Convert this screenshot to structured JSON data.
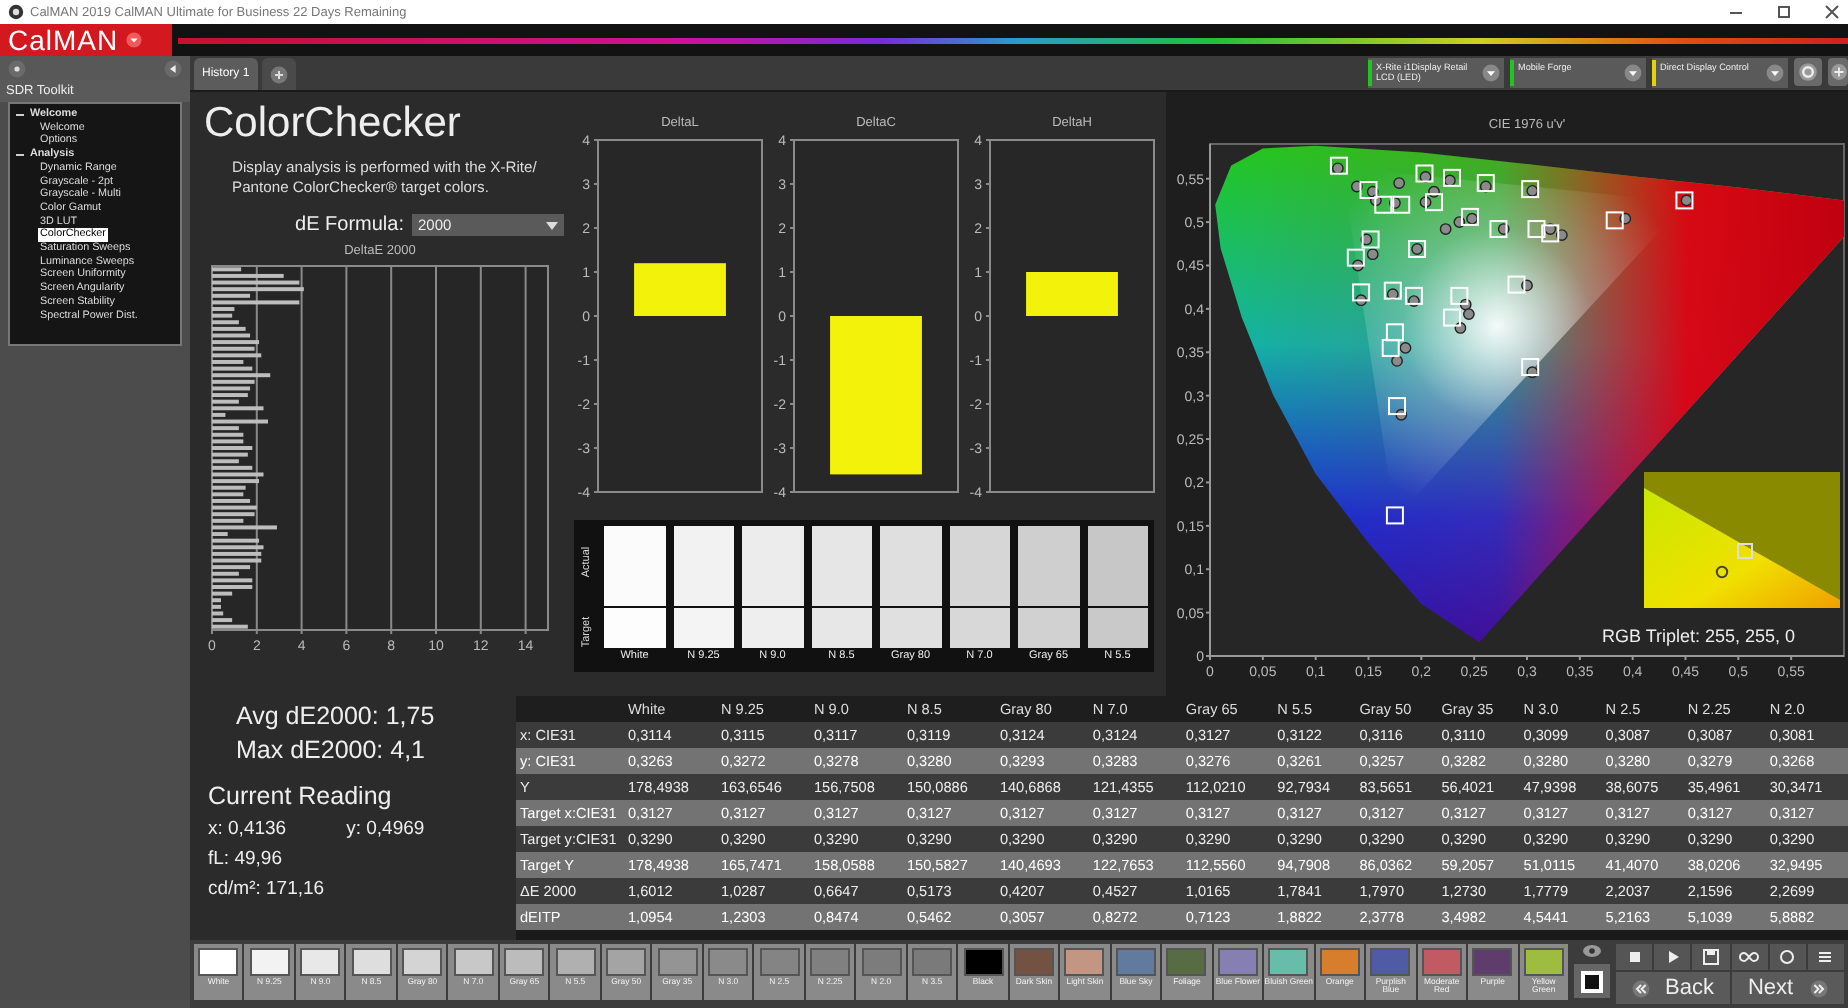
{
  "window": {
    "title": "CalMAN 2019 CalMAN Ultimate for Business 22 Days Remaining"
  },
  "app": {
    "logo": "CalMAN"
  },
  "sidebar": {
    "heading": "SDR Toolkit",
    "items": [
      {
        "label": "Welcome",
        "expanded": true,
        "selected": false,
        "children": [
          {
            "label": "Welcome",
            "selected": false
          },
          {
            "label": "Options",
            "selected": false
          }
        ]
      },
      {
        "label": "Analysis",
        "expanded": true,
        "selected": false,
        "children": [
          {
            "label": "Dynamic Range",
            "selected": false
          },
          {
            "label": "Grayscale - 2pt",
            "selected": false
          },
          {
            "label": "Grayscale - Multi",
            "selected": false
          },
          {
            "label": "Color Gamut",
            "selected": false
          },
          {
            "label": "3D LUT",
            "selected": false
          },
          {
            "label": "ColorChecker",
            "selected": true
          },
          {
            "label": "Saturation Sweeps",
            "selected": false
          },
          {
            "label": "Luminance Sweeps",
            "selected": false
          },
          {
            "label": "Screen Uniformity",
            "selected": false
          },
          {
            "label": "Screen Angularity",
            "selected": false
          },
          {
            "label": "Screen Stability",
            "selected": false
          },
          {
            "label": "Spectral Power Dist.",
            "selected": false
          }
        ]
      }
    ]
  },
  "tabs": [
    {
      "label": "History 1",
      "selected": true
    }
  ],
  "devices": [
    {
      "label": "X-Rite i1Display Retail LCD (LED)",
      "color": "#22c422"
    },
    {
      "label": "Mobile Forge",
      "color": "#22c422"
    },
    {
      "label": "Direct Display Control",
      "color": "#e0d410"
    }
  ],
  "page": {
    "title": "ColorChecker",
    "description": "Display analysis is performed with the X-Rite/ Pantone ColorChecker® target colors.",
    "formula_label": "dE Formula:",
    "formula_value": "2000"
  },
  "delta_e_chart": {
    "chart_data": {
      "type": "bar",
      "orientation": "horizontal",
      "title": "DeltaE 2000",
      "grid": true,
      "xlim": [
        0,
        15
      ],
      "xticks": [
        0,
        2,
        4,
        6,
        8,
        10,
        12,
        14
      ],
      "values": [
        1.3,
        3.2,
        3.9,
        4.1,
        1.7,
        3.9,
        1.0,
        0.9,
        1.2,
        1.5,
        1.7,
        2.1,
        1.9,
        2.2,
        1.4,
        1.8,
        2.6,
        1.9,
        1.7,
        1.6,
        1.2,
        2.3,
        0.6,
        2.5,
        1.2,
        1.4,
        1.4,
        1.8,
        1.6,
        1.2,
        1.8,
        2.3,
        2.1,
        1.5,
        1.4,
        1.7,
        2.0,
        1.9,
        1.4,
        2.9,
        0.7,
        2.1,
        2.3,
        2.2,
        2.2,
        1.7,
        1.2,
        1.8,
        1.8,
        0.9,
        0.4,
        0.4,
        0.5,
        0.9,
        1.6
      ]
    }
  },
  "delta_charts": [
    {
      "chart_data": {
        "type": "bar",
        "orientation": "vertical",
        "title": "DeltaL",
        "categories": [
          null
        ],
        "ylim": [
          -4,
          4
        ],
        "yticks": [
          -4,
          -3,
          -2,
          -1,
          0,
          1,
          2,
          3,
          4
        ],
        "values": [
          1.2
        ]
      }
    },
    {
      "chart_data": {
        "type": "bar",
        "orientation": "vertical",
        "title": "DeltaC",
        "categories": [
          null
        ],
        "ylim": [
          -4,
          4
        ],
        "yticks": [
          -4,
          -3,
          -2,
          -1,
          0,
          1,
          2,
          3,
          4
        ],
        "values": [
          -3.6
        ]
      }
    },
    {
      "chart_data": {
        "type": "bar",
        "orientation": "vertical",
        "title": "DeltaH",
        "categories": [
          null
        ],
        "ylim": [
          -4,
          4
        ],
        "yticks": [
          -4,
          -3,
          -2,
          -1,
          0,
          1,
          2,
          3,
          4
        ],
        "values": [
          1.0
        ]
      }
    }
  ],
  "patch_panel": {
    "actual_label": "Actual",
    "target_label": "Target",
    "patches": [
      {
        "label": "White",
        "actual": {
          "color": "#fbfbfb"
        },
        "target": {
          "color": "#fdfdfd"
        }
      },
      {
        "label": "N 9.25",
        "actual": {
          "color": "#f2f2f2"
        },
        "target": {
          "color": "#f4f4f4"
        }
      },
      {
        "label": "N 9.0",
        "actual": {
          "color": "#ececec"
        },
        "target": {
          "color": "#eeeeee"
        }
      },
      {
        "label": "N 8.5",
        "actual": {
          "color": "#e6e6e6"
        },
        "target": {
          "color": "#e7e7e7"
        }
      },
      {
        "label": "Gray 80",
        "actual": {
          "color": "#dfdfdf"
        },
        "target": {
          "color": "#e0e0e0"
        }
      },
      {
        "label": "N 7.0",
        "actual": {
          "color": "#d6d6d6"
        },
        "target": {
          "color": "#d8d8d8"
        }
      },
      {
        "label": "Gray 65",
        "actual": {
          "color": "#cfcfcf"
        },
        "target": {
          "color": "#d1d1d1"
        }
      },
      {
        "label": "N 5.5",
        "actual": {
          "color": "#c7c7c7"
        },
        "target": {
          "color": "#c9c9c9"
        }
      }
    ]
  },
  "cie_chart": {
    "chart_data": {
      "type": "scatter",
      "title": "CIE 1976 u'v'",
      "xlim": [
        0,
        0.6
      ],
      "ylim": [
        0,
        0.59
      ],
      "xticks": [
        {
          "value": 0,
          "label": "0"
        },
        {
          "value": 0.05,
          "label": "0,05"
        },
        {
          "value": 0.1,
          "label": "0,1"
        },
        {
          "value": 0.15,
          "label": "0,15"
        },
        {
          "value": 0.2,
          "label": "0,2"
        },
        {
          "value": 0.25,
          "label": "0,25"
        },
        {
          "value": 0.3,
          "label": "0,3"
        },
        {
          "value": 0.35,
          "label": "0,35"
        },
        {
          "value": 0.4,
          "label": "0,4"
        },
        {
          "value": 0.45,
          "label": "0,45"
        },
        {
          "value": 0.5,
          "label": "0,5"
        },
        {
          "value": 0.55,
          "label": "0,55"
        }
      ],
      "yticks": [
        {
          "value": 0,
          "label": "0"
        },
        {
          "value": 0.05,
          "label": "0,05"
        },
        {
          "value": 0.1,
          "label": "0,1"
        },
        {
          "value": 0.15,
          "label": "0,15"
        },
        {
          "value": 0.2,
          "label": "0,2"
        },
        {
          "value": 0.25,
          "label": "0,25"
        },
        {
          "value": 0.3,
          "label": "0,3"
        },
        {
          "value": 0.35,
          "label": "0,35"
        },
        {
          "value": 0.4,
          "label": "0,4"
        },
        {
          "value": 0.45,
          "label": "0,45"
        },
        {
          "value": 0.5,
          "label": "0,5"
        },
        {
          "value": 0.55,
          "label": "0,55"
        }
      ],
      "series": [
        {
          "marker": "circle",
          "color": "#8a8a8a",
          "x": [
            0.121,
            0.139,
            0.154,
            0.157,
            0.175,
            0.179,
            0.204,
            0.212,
            0.204,
            0.227,
            0.261,
            0.305,
            0.248,
            0.236,
            0.223,
            0.278,
            0.322,
            0.333,
            0.393,
            0.451,
            0.148,
            0.154,
            0.196,
            0.14,
            0.143,
            0.173,
            0.193,
            0.242,
            0.245,
            0.237,
            0.3,
            0.185,
            0.177,
            0.181,
            0.305
          ],
          "values": [
            0.562,
            0.541,
            0.535,
            0.525,
            0.522,
            0.545,
            0.523,
            0.535,
            0.552,
            0.548,
            0.541,
            0.536,
            0.504,
            0.5,
            0.492,
            0.492,
            0.492,
            0.485,
            0.504,
            0.525,
            0.48,
            0.463,
            0.469,
            0.45,
            0.41,
            0.417,
            0.409,
            0.405,
            0.394,
            0.378,
            0.427,
            0.355,
            0.34,
            0.278,
            0.327
          ]
        },
        {
          "marker": "square",
          "color": "#ffffff",
          "x": [
            0.122,
            0.203,
            0.229,
            0.261,
            0.303,
            0.212,
            0.181,
            0.164,
            0.15,
            0.246,
            0.273,
            0.309,
            0.322,
            0.383,
            0.449,
            0.152,
            0.138,
            0.196,
            0.143,
            0.173,
            0.193,
            0.236,
            0.229,
            0.29,
            0.175,
            0.171,
            0.177,
            0.303,
            0.175
          ],
          "values": [
            0.565,
            0.556,
            0.551,
            0.545,
            0.538,
            0.523,
            0.52,
            0.52,
            0.537,
            0.506,
            0.492,
            0.492,
            0.487,
            0.502,
            0.525,
            0.48,
            0.459,
            0.469,
            0.419,
            0.421,
            0.415,
            0.415,
            0.39,
            0.428,
            0.373,
            0.355,
            0.288,
            0.333,
            0.162
          ]
        }
      ]
    },
    "inset_label": "RGB Triplet: 255, 255, 0"
  },
  "summary": {
    "avg": "Avg dE2000: 1,75",
    "max": "Max dE2000: 4,1",
    "heading": "Current Reading",
    "x": "x: 0,4136",
    "y": "y: 0,4969",
    "fl": "fL: 49,96",
    "luminance": "cd/m²: 171,16"
  },
  "table": {
    "columns": [
      "White",
      "N 9.25",
      "N 9.0",
      "N 8.5",
      "Gray 80",
      "N 7.0",
      "Gray 65",
      "N 5.5",
      "Gray 50",
      "Gray 35",
      "N 3.0",
      "N 2.5",
      "N 2.25",
      "N 2.0"
    ],
    "rows": [
      {
        "label": "x: CIE31",
        "cells": [
          "0,3114",
          "0,3115",
          "0,3117",
          "0,3119",
          "0,3124",
          "0,3124",
          "0,3127",
          "0,3122",
          "0,3116",
          "0,3110",
          "0,3099",
          "0,3087",
          "0,3087",
          "0,3081"
        ]
      },
      {
        "label": "y: CIE31",
        "cells": [
          "0,3263",
          "0,3272",
          "0,3278",
          "0,3280",
          "0,3293",
          "0,3283",
          "0,3276",
          "0,3261",
          "0,3257",
          "0,3282",
          "0,3280",
          "0,3280",
          "0,3279",
          "0,3268"
        ]
      },
      {
        "label": "Y",
        "cells": [
          "178,4938",
          "163,6546",
          "156,7508",
          "150,0886",
          "140,6868",
          "121,4355",
          "112,0210",
          "92,7934",
          "83,5651",
          "56,4021",
          "47,9398",
          "38,6075",
          "35,4961",
          "30,3471"
        ]
      },
      {
        "label": "Target x:CIE31",
        "cells": [
          "0,3127",
          "0,3127",
          "0,3127",
          "0,3127",
          "0,3127",
          "0,3127",
          "0,3127",
          "0,3127",
          "0,3127",
          "0,3127",
          "0,3127",
          "0,3127",
          "0,3127",
          "0,3127"
        ]
      },
      {
        "label": "Target y:CIE31",
        "cells": [
          "0,3290",
          "0,3290",
          "0,3290",
          "0,3290",
          "0,3290",
          "0,3290",
          "0,3290",
          "0,3290",
          "0,3290",
          "0,3290",
          "0,3290",
          "0,3290",
          "0,3290",
          "0,3290"
        ]
      },
      {
        "label": "Target Y",
        "cells": [
          "178,4938",
          "165,7471",
          "158,0588",
          "150,5827",
          "140,4693",
          "122,7653",
          "112,5560",
          "94,7908",
          "86,0362",
          "59,2057",
          "51,0115",
          "41,4070",
          "38,0206",
          "32,9495"
        ]
      },
      {
        "label": "ΔE 2000",
        "cells": [
          "1,6012",
          "1,0287",
          "0,6647",
          "0,5173",
          "0,4207",
          "0,4527",
          "1,0165",
          "1,7841",
          "1,7970",
          "1,2730",
          "1,7779",
          "2,2037",
          "2,1596",
          "2,2699"
        ]
      },
      {
        "label": "dEITP",
        "cells": [
          "1,0954",
          "1,2303",
          "0,8474",
          "0,5462",
          "0,3057",
          "0,8272",
          "0,7123",
          "1,8822",
          "2,3778",
          "3,4982",
          "4,5441",
          "5,2163",
          "5,1039",
          "5,8882"
        ]
      }
    ]
  },
  "swatch_bar": {
    "swatches": [
      {
        "label": "White",
        "color": "#ffffff"
      },
      {
        "label": "N 9.25",
        "color": "#f2f2f2"
      },
      {
        "label": "N 9.0",
        "color": "#e8e8e8"
      },
      {
        "label": "N 8.5",
        "color": "#dedede"
      },
      {
        "label": "Gray 80",
        "color": "#d4d4d4"
      },
      {
        "label": "N 7.0",
        "color": "#c8c8c8"
      },
      {
        "label": "Gray 65",
        "color": "#bcbcbc"
      },
      {
        "label": "N 5.5",
        "color": "#b0b0b0"
      },
      {
        "label": "Gray 50",
        "color": "#a4a4a4"
      },
      {
        "label": "Gray 35",
        "color": "#949494"
      },
      {
        "label": "N 3.0",
        "color": "#8a8a8a"
      },
      {
        "label": "N 2.5",
        "color": "#848484"
      },
      {
        "label": "N 2.25",
        "color": "#808080"
      },
      {
        "label": "N 2.0",
        "color": "#7c7c7c"
      },
      {
        "label": "N 3.5",
        "color": "#7a7a7a"
      },
      {
        "label": "Black",
        "color": "#000000"
      },
      {
        "label": "Dark Skin",
        "color": "#735244"
      },
      {
        "label": "Light Skin",
        "color": "#c29682"
      },
      {
        "label": "Blue Sky",
        "color": "#627a9d"
      },
      {
        "label": "Foliage",
        "color": "#576c43"
      },
      {
        "label": "Blue Flower",
        "color": "#8580b1"
      },
      {
        "label": "Bluish Green",
        "color": "#67bdaa"
      },
      {
        "label": "Orange",
        "color": "#d67e2c"
      },
      {
        "label": "Purplish Blue",
        "color": "#505ba6"
      },
      {
        "label": "Moderate Red",
        "color": "#c15a63"
      },
      {
        "label": "Purple",
        "color": "#5e3c6c"
      },
      {
        "label": "Yellow Green",
        "color": "#9dbc40"
      }
    ]
  },
  "controls": {
    "back": "Back",
    "next": "Next"
  }
}
